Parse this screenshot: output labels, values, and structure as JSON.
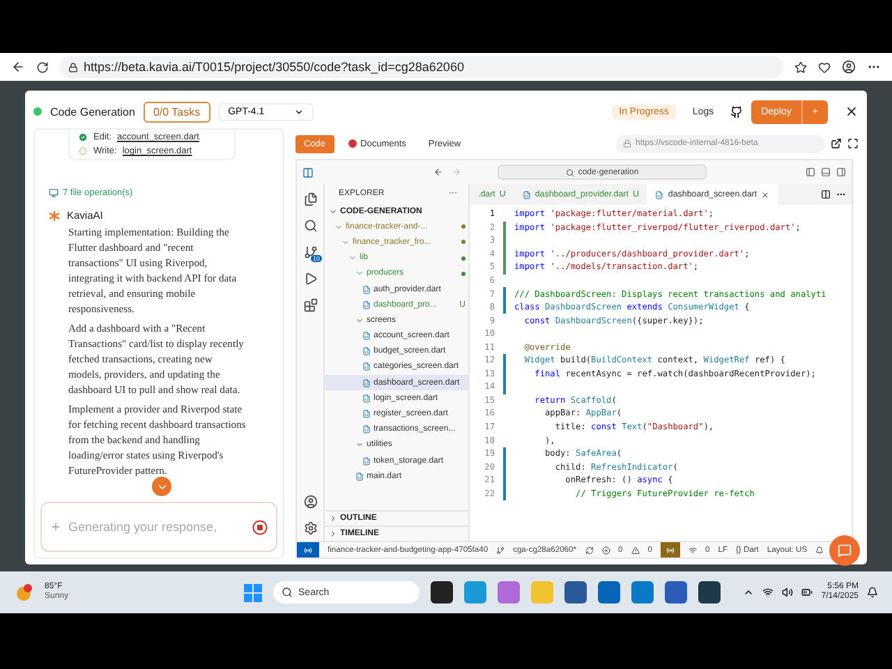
{
  "browser": {
    "url": "https://beta.kavia.ai/T0015/project/30550/code?task_id=cg28a62060"
  },
  "header": {
    "title": "Code Generation",
    "tasks": "0/0 Tasks",
    "model": "GPT-4.1",
    "status": "In Progress",
    "logs": "Logs",
    "deploy": "Deploy",
    "deploy_plus": "+"
  },
  "chat": {
    "file_ops": [
      {
        "action": "Edit:",
        "file": "account_screen.dart",
        "done": true
      },
      {
        "action": "Write:",
        "file": "login_screen.dart",
        "done": false
      }
    ],
    "ops_summary": "7 file operation(s)",
    "sender": "KaviaAI",
    "paragraphs": [
      "Starting implementation: Building the Flutter dashboard and \"recent transactions\" UI using Riverpod, integrating it with backend API for data retrieval, and ensuring mobile responsiveness.",
      "Add a dashboard with a \"Recent Transactions\" card/list to display recently fetched transactions, creating new models, providers, and updating the dashboard UI to pull and show real data.",
      "Implement a provider and Riverpod state for fetching recent dashboard transactions from the backend and handling loading/error states using Riverpod's FutureProvider pattern."
    ],
    "input": {
      "placeholder": "Generating your response,"
    }
  },
  "preview": {
    "tabs": [
      {
        "label": "Code",
        "selected": true
      },
      {
        "label": "Documents",
        "selected": false
      },
      {
        "label": "Preview",
        "selected": false
      }
    ],
    "url": "https://vscode-internal-4816-beta"
  },
  "vscode": {
    "search": "code-generation",
    "scm_badge": "10",
    "explorer_title": "EXPLORER",
    "explorer_more": "···",
    "root": "CODE-GENERATION",
    "tree": [
      {
        "label": "finance-tracker-and-...",
        "expanded": true,
        "color": "#8a7a2a",
        "selected": false,
        "children": [
          {
            "label": "finance_tracker_fro...",
            "expanded": true,
            "color": "#8a7a2a",
            "selected": false,
            "children": [
              {
                "label": "lib",
                "expanded": true,
                "color": "#3a8a3a",
                "selected": false,
                "children": [
                  {
                    "label": "producers",
                    "expanded": true,
                    "color": "#3a8a3a",
                    "selected": false,
                    "children": [
                      {
                        "label": "auth_provider.dart",
                        "selected": false
                      },
                      {
                        "label": "dashboard_pro...",
                        "color": "#3a8a3a",
                        "badge": "U",
                        "selected": false
                      }
                    ]
                  },
                  {
                    "label": "screens",
                    "expanded": true,
                    "selected": false,
                    "children": [
                      {
                        "label": "account_screen.dart",
                        "selected": false
                      },
                      {
                        "label": "budget_screen.dart",
                        "selected": false
                      },
                      {
                        "label": "categories_screen.dart",
                        "selected": false
                      },
                      {
                        "label": "dashboard_screen.dart",
                        "selected": true
                      },
                      {
                        "label": "login_screen.dart",
                        "selected": false
                      },
                      {
                        "label": "register_screen.dart",
                        "selected": false
                      },
                      {
                        "label": "transactions_screen...",
                        "selected": false
                      }
                    ]
                  },
                  {
                    "label": "utilities",
                    "expanded": true,
                    "selected": false,
                    "children": [
                      {
                        "label": "token_storage.dart",
                        "selected": false
                      }
                    ]
                  },
                  {
                    "label": "main.dart",
                    "selected": false
                  }
                ]
              }
            ]
          }
        ]
      }
    ],
    "sections": [
      {
        "label": "OUTLINE",
        "expanded": false
      },
      {
        "label": "TIMELINE",
        "expanded": false
      }
    ],
    "tabs": [
      {
        "label": ".dart",
        "badge": "U",
        "selected": false
      },
      {
        "label": "dashboard_provider.dart",
        "badge": "U",
        "selected": false
      },
      {
        "label": "dashboard_screen.dart",
        "selected": true
      }
    ],
    "lines": [
      {
        "n": "1",
        "tokens": [
          {
            "text": "import ",
            "kind": "kw"
          },
          {
            "text": "'package:flutter/material.dart'",
            "kind": "str"
          },
          {
            "text": ";",
            "kind": "plain"
          }
        ]
      },
      {
        "n": "2",
        "color": "#48985d",
        "tokens": [
          {
            "text": "import ",
            "kind": "kw"
          },
          {
            "text": "'package:flutter_riverpod/flutter_riverpod.dart'",
            "kind": "str"
          },
          {
            "text": ";",
            "kind": "plain"
          }
        ]
      },
      {
        "n": "3",
        "color": "#48985d"
      },
      {
        "n": "4",
        "color": "#48985d",
        "tokens": [
          {
            "text": "import ",
            "kind": "kw"
          },
          {
            "text": "'../producers/dashboard_provider.dart'",
            "kind": "str"
          },
          {
            "text": ";",
            "kind": "plain"
          }
        ]
      },
      {
        "n": "5",
        "color": "#48985d",
        "tokens": [
          {
            "text": "import ",
            "kind": "kw"
          },
          {
            "text": "'../models/transaction.dart'",
            "kind": "str"
          },
          {
            "text": ";",
            "kind": "plain"
          }
        ]
      },
      {
        "n": "6"
      },
      {
        "n": "7",
        "color": "#1b81a8",
        "tokens": [
          {
            "text": "/// DashboardScreen: Displays recent transactions and analyti",
            "kind": "cm"
          }
        ]
      },
      {
        "n": "8",
        "color": "#1b81a8",
        "tokens": [
          {
            "text": "class ",
            "kind": "kw"
          },
          {
            "text": "DashboardScreen ",
            "kind": "type"
          },
          {
            "text": "extends ",
            "kind": "kw"
          },
          {
            "text": "ConsumerWidget ",
            "kind": "type"
          },
          {
            "text": "{",
            "kind": "plain"
          }
        ]
      },
      {
        "n": "9",
        "tokens": [
          {
            "text": "  const ",
            "kind": "kw"
          },
          {
            "text": "DashboardScreen",
            "kind": "type"
          },
          {
            "text": "({super.key});",
            "kind": "plain"
          }
        ]
      },
      {
        "n": "10"
      },
      {
        "n": "11",
        "tokens": [
          {
            "text": "  @override",
            "kind": "fn"
          }
        ]
      },
      {
        "n": "12",
        "color": "#1b81a8",
        "tokens": [
          {
            "text": "  Widget ",
            "kind": "type"
          },
          {
            "text": "build(",
            "kind": "plain"
          },
          {
            "text": "BuildContext ",
            "kind": "type"
          },
          {
            "text": "context, ",
            "kind": "plain"
          },
          {
            "text": "WidgetRef ",
            "kind": "type"
          },
          {
            "text": "ref) {",
            "kind": "plain"
          }
        ]
      },
      {
        "n": "13",
        "color": "#1b81a8",
        "tokens": [
          {
            "text": "    final ",
            "kind": "kw"
          },
          {
            "text": "recentAsync = ref.watch(dashboardRecentProvider);",
            "kind": "plain"
          }
        ]
      },
      {
        "n": "14",
        "color": "#1b81a8"
      },
      {
        "n": "15",
        "tokens": [
          {
            "text": "    return ",
            "kind": "kw"
          },
          {
            "text": "Scaffold",
            "kind": "type"
          },
          {
            "text": "(",
            "kind": "plain"
          }
        ]
      },
      {
        "n": "16",
        "tokens": [
          {
            "text": "      appBar: ",
            "kind": "plain"
          },
          {
            "text": "AppBar",
            "kind": "type"
          },
          {
            "text": "(",
            "kind": "plain"
          }
        ]
      },
      {
        "n": "17",
        "tokens": [
          {
            "text": "        title: ",
            "kind": "plain"
          },
          {
            "text": "const ",
            "kind": "kw"
          },
          {
            "text": "Text",
            "kind": "type"
          },
          {
            "text": "(",
            "kind": "plain"
          },
          {
            "text": "\"Dashboard\"",
            "kind": "str"
          },
          {
            "text": "),",
            "kind": "plain"
          }
        ]
      },
      {
        "n": "18",
        "tokens": [
          {
            "text": "      ),",
            "kind": "plain"
          }
        ]
      },
      {
        "n": "19",
        "color": "#1b81a8",
        "tokens": [
          {
            "text": "      body: ",
            "kind": "plain"
          },
          {
            "text": "SafeArea",
            "kind": "type"
          },
          {
            "text": "(",
            "kind": "plain"
          }
        ]
      },
      {
        "n": "20",
        "color": "#1b81a8",
        "tokens": [
          {
            "text": "        child: ",
            "kind": "plain"
          },
          {
            "text": "RefreshIndicator",
            "kind": "type"
          },
          {
            "text": "(",
            "kind": "plain"
          }
        ]
      },
      {
        "n": "21",
        "color": "#1b81a8",
        "tokens": [
          {
            "text": "          onRefresh: () ",
            "kind": "plain"
          },
          {
            "text": "async ",
            "kind": "kw"
          },
          {
            "text": "{",
            "kind": "plain"
          }
        ]
      },
      {
        "n": "22",
        "color": "#1b81a8",
        "tokens": [
          {
            "text": "            // Triggers FutureProvider re-fetch",
            "kind": "cm"
          }
        ]
      }
    ],
    "status": {
      "repo": "finance-tracker-and-budgeting-app-4705fa40",
      "branch": "cga-cg28a62060*",
      "errors": "0",
      "warnings": "0",
      "ports": "0",
      "eol": "LF",
      "lang": "{} Dart",
      "layout": "Layout: US"
    }
  },
  "taskbar": {
    "temp": "85°F",
    "weather": "Sunny",
    "search": "Search",
    "time": "5:56 PM",
    "date": "7/14/2025"
  }
}
